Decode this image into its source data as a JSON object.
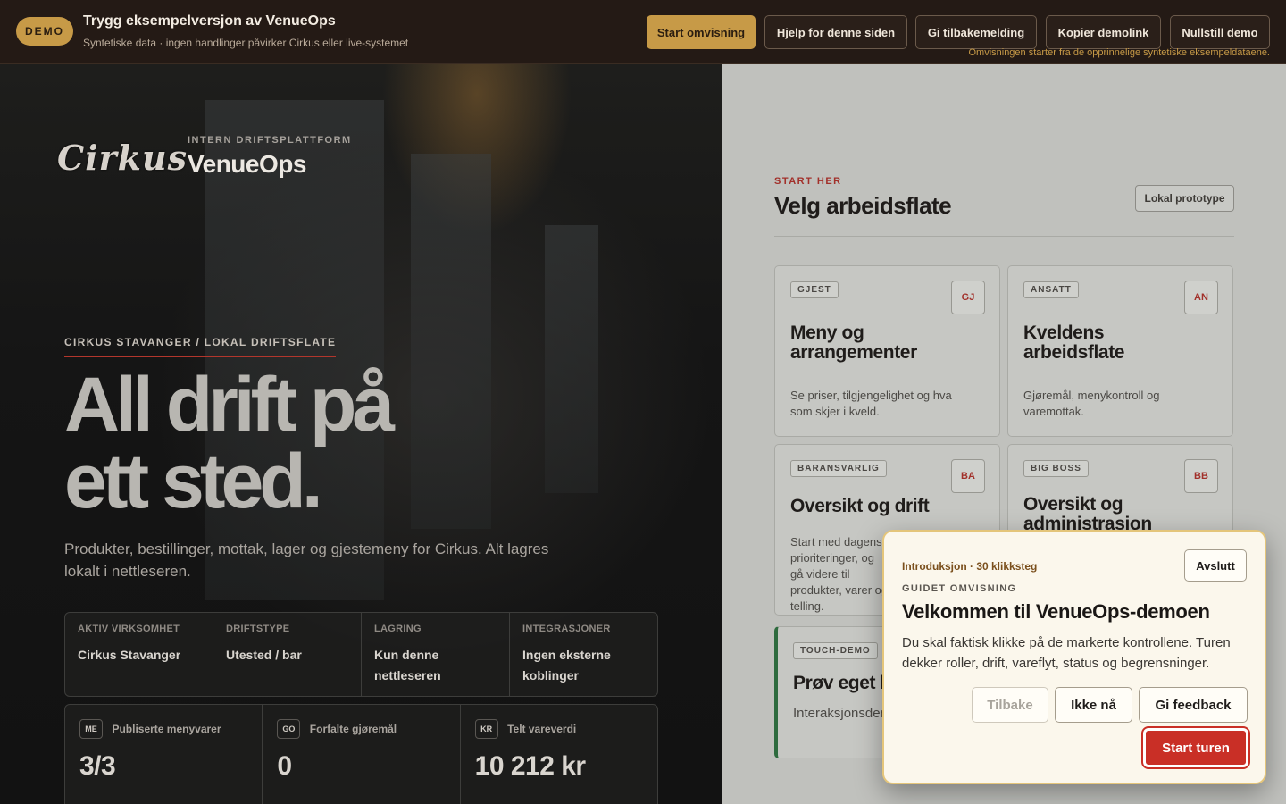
{
  "topbar": {
    "demo_badge": "DEMO",
    "title": "Trygg eksempelversjon av VenueOps",
    "subtitle": "Syntetiske data · ingen handlinger påvirker Cirkus eller live-systemet",
    "buttons": {
      "start_tour": "Start omvisning",
      "help": "Hjelp for denne siden",
      "feedback": "Gi tilbakemelding",
      "copy_link": "Kopier demolink",
      "reset": "Nullstill demo"
    },
    "note": "Omvisningen starter fra de opprinnelige syntetiske eksempeldataene."
  },
  "hero": {
    "logo_text": "Cirkus",
    "platform_kicker": "INTERN DRIFTSPLATTFORM",
    "brand": "VenueOps",
    "eyebrow": "CIRKUS STAVANGER / LOKAL DRIFTSFLATE",
    "headline_line1": "All drift på",
    "headline_line2": "ett sted.",
    "lead": "Produkter, bestillinger, mottak, lager og gjestemeny for Cirkus. Alt lagres lokalt i nettleseren.",
    "facts": [
      {
        "label": "AKTIV VIRKSOMHET",
        "value": "Cirkus Stavanger"
      },
      {
        "label": "DRIFTSTYPE",
        "value": "Utested / bar"
      },
      {
        "label": "LAGRING",
        "value": "Kun denne nettleseren"
      },
      {
        "label": "INTEGRASJONER",
        "value": "Ingen eksterne koblinger"
      }
    ],
    "stats": [
      {
        "badge": "ME",
        "label": "Publiserte menyvarer",
        "value": "3/3",
        "color": "#a8332c"
      },
      {
        "badge": "GO",
        "label": "Forfalte gjøremål",
        "value": "0",
        "color": "#8a5a22"
      },
      {
        "badge": "KR",
        "label": "Telt vareverdi",
        "value": "10 212 kr",
        "color": "#2e6b3e"
      }
    ]
  },
  "workspace": {
    "kicker": "START HER",
    "title": "Velg arbeidsflate",
    "prototype_button": "Lokal prototype",
    "cards": [
      {
        "role": "GJEST",
        "initials": "GJ",
        "title": "Meny og arrangementer",
        "desc": "Se priser, tilgjengelighet og hva som skjer i kveld."
      },
      {
        "role": "ANSATT",
        "initials": "AN",
        "title": "Kveldens arbeidsflate",
        "desc": "Gjøremål, menykontroll og varemottak."
      },
      {
        "role": "BARANSVARLIG",
        "initials": "BA",
        "title": "Oversikt og drift",
        "desc": "Start med dagens prioriteringer, og gå videre til produkter, varer og telling."
      },
      {
        "role": "BIG BOSS",
        "initials": "BB",
        "title": "Oversikt og administrasjon",
        "desc": ""
      }
    ],
    "touch_card": {
      "role": "TOUCH-DEMO",
      "title": "Prøv eget kjøkken",
      "desc": "Interaksjonsdemo for lagerføring."
    }
  },
  "tour": {
    "step_label": "Introduksjon · 30 klikksteg",
    "exit": "Avslutt",
    "kicker": "GUIDET OMVISNING",
    "title": "Velkommen til VenueOps-demoen",
    "text": "Du skal faktisk klikke på de markerte kontrollene. Turen dekker roller, drift, vareflyt, status og begrensninger.",
    "back": "Tilbake",
    "not_now": "Ikke nå",
    "give_feedback": "Gi feedback",
    "start": "Start turen"
  },
  "colors": {
    "accent_gold": "#c79a47",
    "accent_red": "#c92f26",
    "accent_green": "#2e6b3e"
  }
}
